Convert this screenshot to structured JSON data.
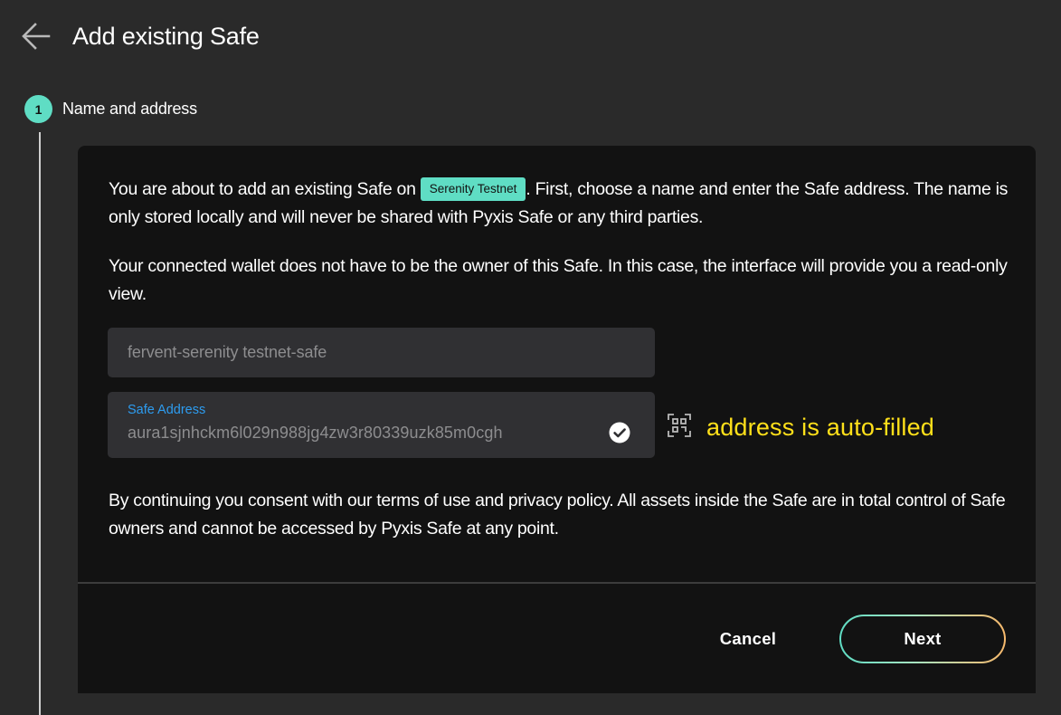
{
  "header": {
    "title": "Add existing Safe"
  },
  "stepper": {
    "step_number": "1",
    "step_label": "Name and address"
  },
  "card": {
    "intro_before": "You are about to add an existing Safe on ",
    "chain_name": "Serenity Testnet",
    "intro_after": ". First, choose a name and enter the Safe address. The name is only stored locally and will never be shared with Pyxis Safe or any third parties.",
    "readonly_note": "Your connected wallet does not have to be the owner of this Safe. In this case, the interface will provide you a read-only view.",
    "name_field": {
      "placeholder": "fervent-serenity testnet-safe"
    },
    "address_field": {
      "label": "Safe Address",
      "value": "aura1sjnhckm6l029n988jg4zw3r80339uzk85m0cgh"
    },
    "annotation": "address is auto-filled",
    "consent": "By continuing you consent with our terms of use and privacy policy. All assets inside the Safe are in total control of Safe owners and cannot be accessed by Pyxis Safe at any point."
  },
  "actions": {
    "cancel_label": "Cancel",
    "next_label": "Next"
  },
  "icons": {
    "back": "arrow-left-icon",
    "check": "check-circle-icon",
    "qr": "qr-scan-icon"
  },
  "colors": {
    "accent": "#5fddc4",
    "annotation": "#ffe01a",
    "field_label": "#2d9cf0"
  }
}
